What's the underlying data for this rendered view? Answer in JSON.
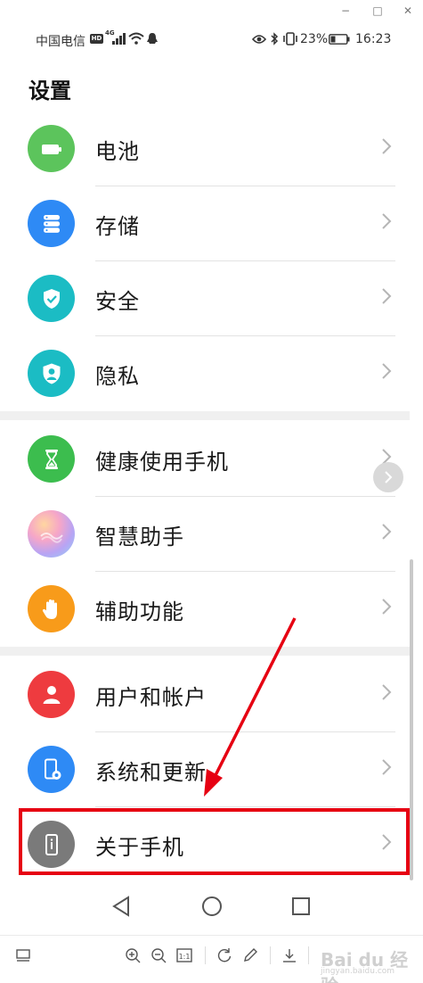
{
  "window": {
    "minimize": "−",
    "maximize": "□",
    "close": "✕"
  },
  "status_bar": {
    "carrier": "中国电信",
    "hd": "HD",
    "network": "4G",
    "battery_percent": "23%",
    "time": "16:23"
  },
  "page": {
    "title": "设置"
  },
  "items": [
    {
      "label": "电池",
      "icon": "battery-icon",
      "color": "#5cc45c"
    },
    {
      "label": "存储",
      "icon": "storage-icon",
      "color": "#2e8af5"
    },
    {
      "label": "安全",
      "icon": "shield-check-icon",
      "color": "#1bbcc4"
    },
    {
      "label": "隐私",
      "icon": "privacy-icon",
      "color": "#1bbcc4"
    },
    {
      "label": "健康使用手机",
      "icon": "hourglass-icon",
      "color": "#3cbd4e"
    },
    {
      "label": "智慧助手",
      "icon": "assistant-icon",
      "color": "#c9a8f0"
    },
    {
      "label": "辅助功能",
      "icon": "hand-icon",
      "color": "#f89b1a"
    },
    {
      "label": "用户和帐户",
      "icon": "user-icon",
      "color": "#ee3b3f"
    },
    {
      "label": "系统和更新",
      "icon": "phone-settings-icon",
      "color": "#2e8af5"
    },
    {
      "label": "关于手机",
      "icon": "info-phone-icon",
      "color": "#7a7a7a"
    }
  ],
  "annotation": {
    "highlight_color": "#e60012"
  },
  "watermark": {
    "text": "Bai du 经验",
    "sub": "jingyan.baidu.com"
  }
}
